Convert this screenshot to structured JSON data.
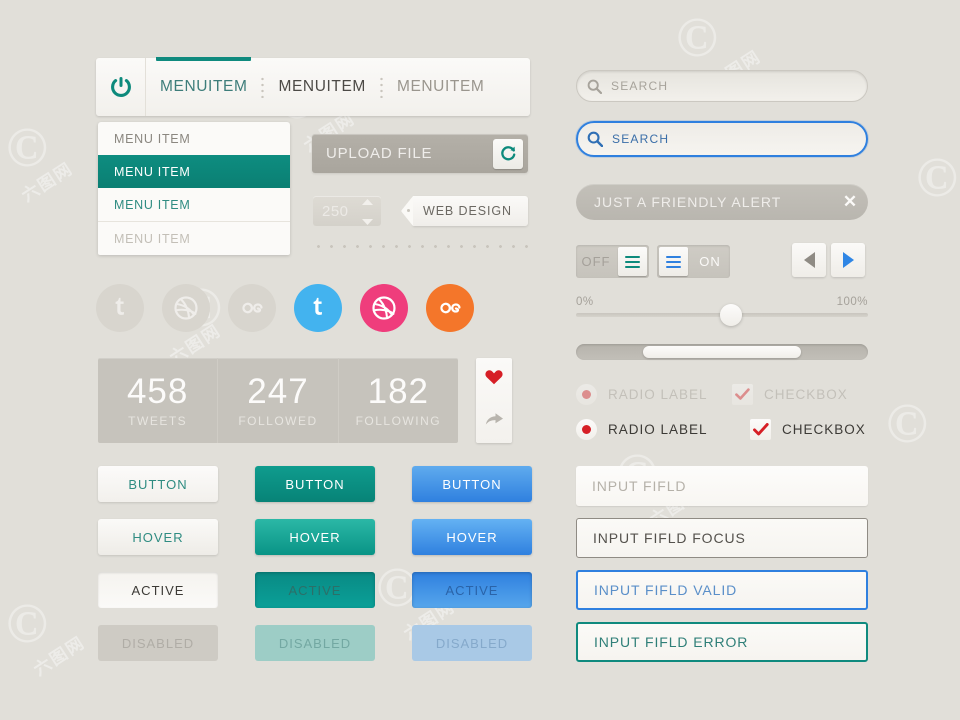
{
  "meta": {
    "background": "#e1dfd9",
    "accent_teal": "#0f8a7e",
    "accent_blue": "#2f80df",
    "accent_red": "#d61f26"
  },
  "watermarks": {
    "circle_glyph": "©",
    "text": "六图网"
  },
  "topnav": {
    "logo_icon": "power-icon",
    "items": [
      {
        "label": "MENUITEM",
        "state": "active"
      },
      {
        "label": "MENUITEM",
        "state": "hover"
      },
      {
        "label": "MENUITEM",
        "state": "normal"
      }
    ]
  },
  "dropdown": {
    "items": [
      {
        "label": "MENU ITEM",
        "state": "normal"
      },
      {
        "label": "MENU ITEM",
        "state": "selected"
      },
      {
        "label": "MENU ITEM",
        "state": "teal"
      },
      {
        "label": "MENU ITEM",
        "state": "disabled"
      }
    ]
  },
  "upload": {
    "label": "UPLOAD FILE",
    "button_icon": "refresh-icon"
  },
  "spinner": {
    "value": "250",
    "up_icon": "caret-up-icon",
    "down_icon": "caret-down-icon"
  },
  "tag": {
    "label": "WEB DESIGN"
  },
  "social": {
    "disabled": [
      {
        "name": "twitter-icon",
        "glyph": "t"
      },
      {
        "name": "dribbble-icon",
        "glyph": "d"
      },
      {
        "name": "lastfm-icon",
        "glyph": "as"
      }
    ],
    "active": [
      {
        "name": "twitter-icon",
        "glyph": "t",
        "color": "#43b3ef"
      },
      {
        "name": "dribbble-icon",
        "glyph": "d",
        "color": "#ef3d7c"
      },
      {
        "name": "lastfm-icon",
        "glyph": "as",
        "color": "#f4762a"
      }
    ]
  },
  "stats": [
    {
      "number": "458",
      "label": "TWEETS"
    },
    {
      "number": "247",
      "label": "FOLLOWED"
    },
    {
      "number": "182",
      "label": "FOLLOWING"
    }
  ],
  "actions": {
    "heart_icon": "heart-icon",
    "share_icon": "share-arrow-icon",
    "heart_color": "#d61f26",
    "share_color": "#b8b4ad"
  },
  "buttons": {
    "columns": [
      "white",
      "teal",
      "blue"
    ],
    "rows": [
      {
        "label": "BUTTON"
      },
      {
        "label": "HOVER"
      },
      {
        "label": "ACTIVE"
      },
      {
        "label": "DISABLED"
      }
    ],
    "white": [
      "BUTTON",
      "HOVER",
      "ACTIVE",
      "DISABLED"
    ],
    "teal": [
      "BUTTON",
      "HOVER",
      "ACTIVE",
      "DISABLED"
    ],
    "blue": [
      "BUTTON",
      "HOVER",
      "ACTIVE",
      "DISABLED"
    ]
  },
  "search": {
    "default": {
      "value": "SEARCH",
      "icon": "search-icon"
    },
    "focus": {
      "value": "SEARCH",
      "icon": "search-icon"
    }
  },
  "alert": {
    "message": "JUST A FRIENDLY ALERT",
    "close_icon": "close-icon"
  },
  "toggles": [
    {
      "label": "OFF",
      "state": "off",
      "handle_color": "#0d8a7c",
      "handle_side": "right"
    },
    {
      "label": "ON",
      "state": "on",
      "handle_color": "#2f80df",
      "handle_side": "left"
    }
  ],
  "arrows": [
    {
      "name": "arrow-left-icon",
      "direction": "left",
      "color": "#8f8b84"
    },
    {
      "name": "arrow-right-icon",
      "direction": "right",
      "color": "#2f86e5"
    }
  ],
  "slider": {
    "min_label": "0%",
    "max_label": "100%",
    "value_percent": 53
  },
  "scrollbar": {
    "thumb_start_percent": 23,
    "thumb_width_percent": 54
  },
  "radios": [
    {
      "label": "RADIO LABEL",
      "checked": true,
      "state": "disabled"
    },
    {
      "label": "RADIO LABEL",
      "checked": true,
      "state": "active"
    }
  ],
  "checkboxes": [
    {
      "label": "CHECKBOX",
      "checked": true,
      "state": "disabled"
    },
    {
      "label": "CHECKBOX",
      "checked": true,
      "state": "active"
    }
  ],
  "inputs": [
    {
      "value": "INPUT FIFLD",
      "state": "default"
    },
    {
      "value": "INPUT FIFLD FOCUS",
      "state": "focus"
    },
    {
      "value": "INPUT FIFLD VALID",
      "state": "valid"
    },
    {
      "value": "INPUT FIFLD ERROR",
      "state": "error"
    }
  ]
}
